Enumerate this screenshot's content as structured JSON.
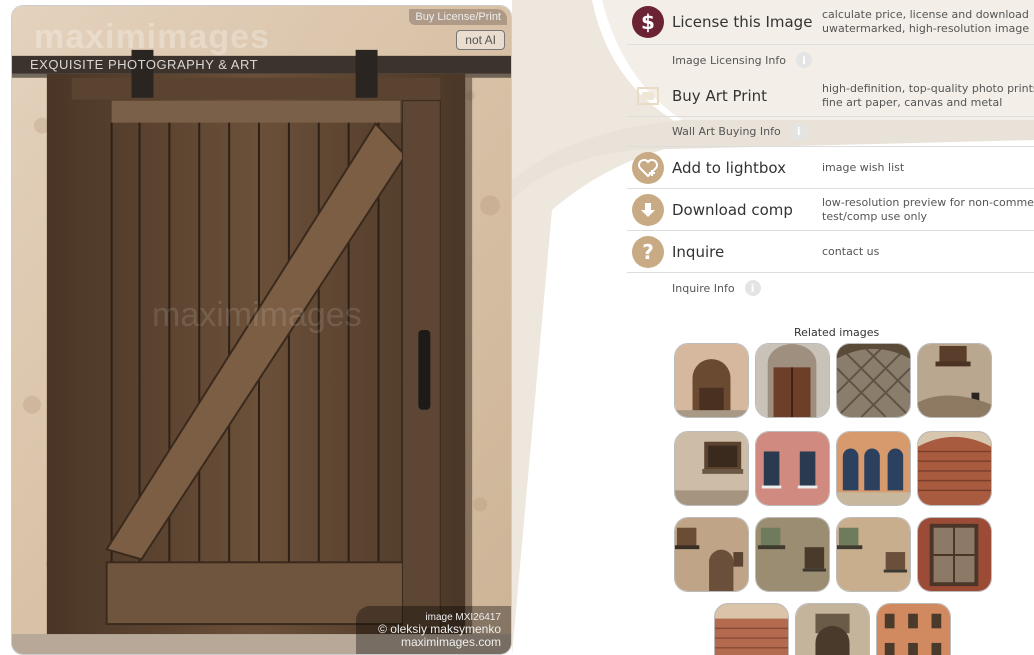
{
  "photo": {
    "buy_label": "Buy License/Print",
    "not_ai_label": "not AI",
    "brand": "maximimages",
    "brand_tagline": "EXQUISITE PHOTOGRAPHY & ART",
    "watermark": "maximimages",
    "credit_id": "image MXI26417",
    "credit_name": "© oleksiy maksymenko",
    "credit_site": "maximimages.com"
  },
  "actions": [
    {
      "label": "License this Image",
      "desc1": "calculate price, license and download",
      "desc2": "uwatermarked, high-resolution image",
      "icon": "dollar-icon",
      "color": "#6b2233"
    },
    {
      "label": "Buy Art Print",
      "desc1": "high-definition, top-quality photo prints on",
      "desc2": "fine art paper, canvas and metal",
      "icon": "frame-icon",
      "color": "#f1ece4"
    },
    {
      "label": "Add to lightbox",
      "desc1": "image wish list",
      "desc2": "",
      "icon": "heart-plus-icon",
      "color": "#c8ab85"
    },
    {
      "label": "Download comp",
      "desc1": "low-resolution preview for non-commercial",
      "desc2": "test/comp use only",
      "icon": "download-icon",
      "color": "#c8ab85"
    },
    {
      "label": "Inquire",
      "desc1": "contact us",
      "desc2": "",
      "icon": "question-icon",
      "color": "#c8ab85"
    }
  ],
  "info_links": {
    "licensing": "Image Licensing Info",
    "wall_art": "Wall Art Buying Info",
    "inquire": "Inquire Info"
  },
  "related": {
    "title": "Related images"
  },
  "colors": {
    "accent": "#6b2233",
    "tan": "#c8ab85"
  }
}
